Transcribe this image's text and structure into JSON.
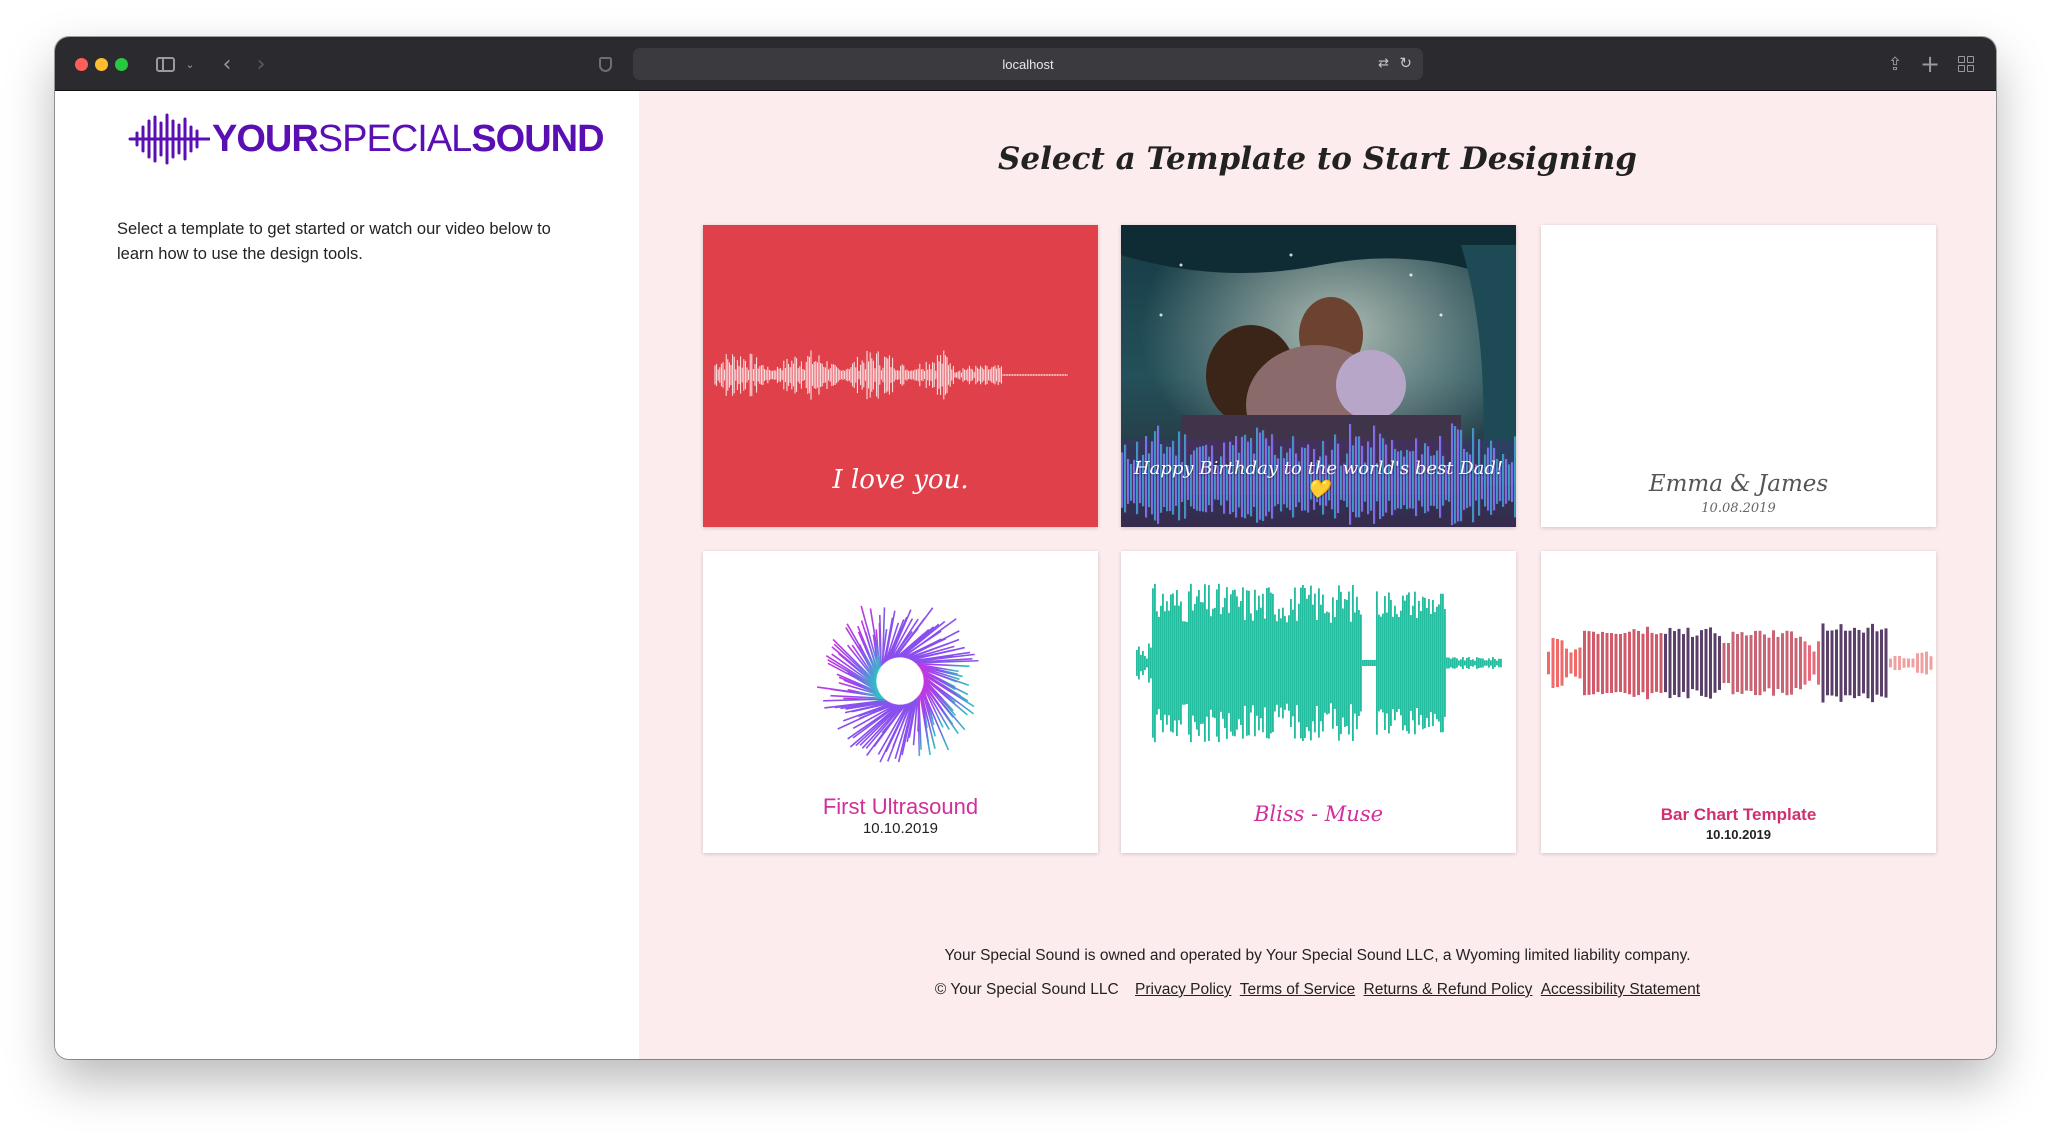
{
  "browser": {
    "url": "localhost"
  },
  "sidebar": {
    "logo": {
      "part1": "YOUR",
      "part2": "SPECIAL",
      "part3": "SOUND",
      "color": "#5a0fb3"
    },
    "intro_text": "Select a template to get started or watch our video below to learn how to use the design tools."
  },
  "main": {
    "heading": "Select a Template to Start Designing",
    "templates": [
      {
        "caption": "I love you.",
        "background": "#e04049"
      },
      {
        "caption": "Happy Birthday to the world's best Dad! 💛"
      },
      {
        "title": "Emma & James",
        "date": "10.08.2019"
      },
      {
        "title": "First Ultrasound",
        "date": "10.10.2019"
      },
      {
        "title": "Bliss - Muse"
      },
      {
        "title": "Bar Chart Template",
        "date": "10.10.2019"
      }
    ]
  },
  "footer": {
    "ownership": "Your Special Sound is owned and operated by Your Special Sound LLC, a Wyoming limited liability company.",
    "copyright": "© Your Special Sound LLC",
    "links": [
      "Privacy Policy",
      "Terms of Service",
      "Returns & Refund Policy",
      "Accessibility Statement"
    ]
  },
  "colors": {
    "right_pane_bg": "#fdeced",
    "accent_pink": "#d12f9a"
  }
}
